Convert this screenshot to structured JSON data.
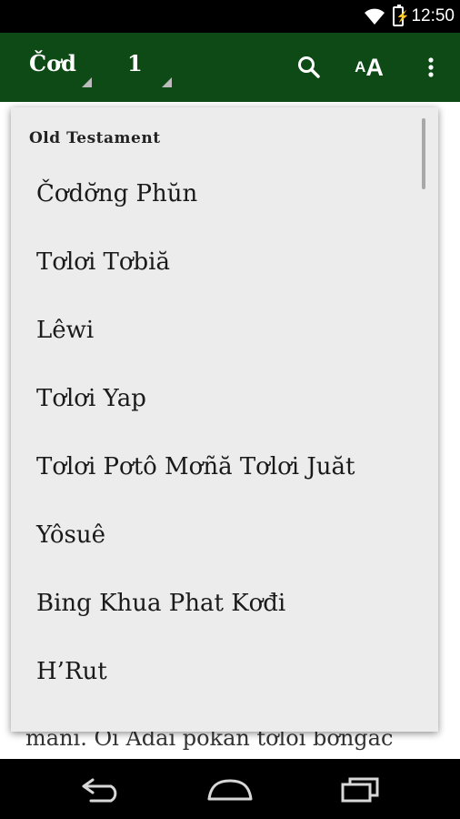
{
  "status_bar": {
    "time": "12:50"
  },
  "app_bar": {
    "book": "Čơd",
    "chapter": "1",
    "text_size_label": "AA"
  },
  "background_text": {
    "line1": "mani. Oi Adai pokan tơloi bơngac"
  },
  "dropdown": {
    "section_title": "Old Testament",
    "books": [
      "Čơdơ̆ng Phŭn",
      "Tơlơi Tơbiă",
      "Lêwi",
      "Tơlơi Yap",
      "Tơlơi Pơtô Mơñă Tơlơi Juăt",
      "Yôsuê",
      "Bing Khua Phat Kơđi",
      "H’Rut"
    ]
  },
  "colors": {
    "app_bar": "#0d4a16",
    "dropdown_bg": "#ececec",
    "status_bar": "#000000"
  }
}
